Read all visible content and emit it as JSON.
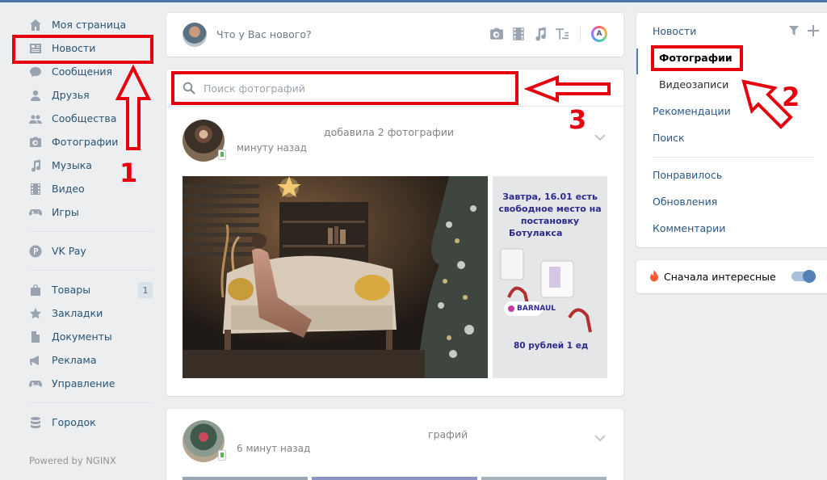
{
  "left_nav": {
    "items": [
      {
        "label": "Моя страница",
        "icon": "home-icon"
      },
      {
        "label": "Новости",
        "icon": "news-icon"
      },
      {
        "label": "Сообщения",
        "icon": "message-icon"
      },
      {
        "label": "Друзья",
        "icon": "user-icon"
      },
      {
        "label": "Сообщества",
        "icon": "users-icon"
      },
      {
        "label": "Фотографии",
        "icon": "camera-icon"
      },
      {
        "label": "Музыка",
        "icon": "music-icon"
      },
      {
        "label": "Видео",
        "icon": "video-icon"
      },
      {
        "label": "Игры",
        "icon": "gamepad-icon"
      }
    ],
    "pay": {
      "label": "VK Pay",
      "icon": "vkpay-icon"
    },
    "items2": [
      {
        "label": "Товары",
        "icon": "bag-icon",
        "badge": "1"
      },
      {
        "label": "Закладки",
        "icon": "star-icon"
      },
      {
        "label": "Документы",
        "icon": "document-icon"
      },
      {
        "label": "Реклама",
        "icon": "megaphone-icon"
      },
      {
        "label": "Управление",
        "icon": "gamepad-icon"
      }
    ],
    "extra": {
      "label": "Городок",
      "icon": "database-icon"
    },
    "powered": "Powered by NGINX"
  },
  "compose": {
    "placeholder": "Что у Вас нового?",
    "tools": [
      "camera-icon",
      "video-icon",
      "music-icon",
      "text-icon",
      "app-icon"
    ],
    "app_letter": "A"
  },
  "search": {
    "placeholder": "Поиск фотографий"
  },
  "post1": {
    "action_text": "добавила 2 фотографии",
    "time": "минуту назад",
    "photo2_text": {
      "line1": "Завтра, 16.01 есть",
      "line2": "свободное место на",
      "line3": "постановку",
      "line4": "Ботулакса",
      "location": "BARNAUL",
      "price": "80 рублей 1 ед"
    }
  },
  "post2": {
    "action_text": "графий",
    "time": "6 минут назад"
  },
  "right_menu": {
    "items": [
      "Новости",
      "Фотографии",
      "Видеозаписи",
      "Рекомендации",
      "Поиск"
    ],
    "items2": [
      "Понравилось",
      "Обновления",
      "Комментарии"
    ]
  },
  "toggle": {
    "label": "Сначала интересные",
    "on": true
  },
  "annotations": {
    "n1": "1",
    "n2": "2",
    "n3": "3"
  },
  "colors": {
    "accent": "#5181b8",
    "annotation_red": "#e4000f",
    "background": "#edeef0"
  }
}
